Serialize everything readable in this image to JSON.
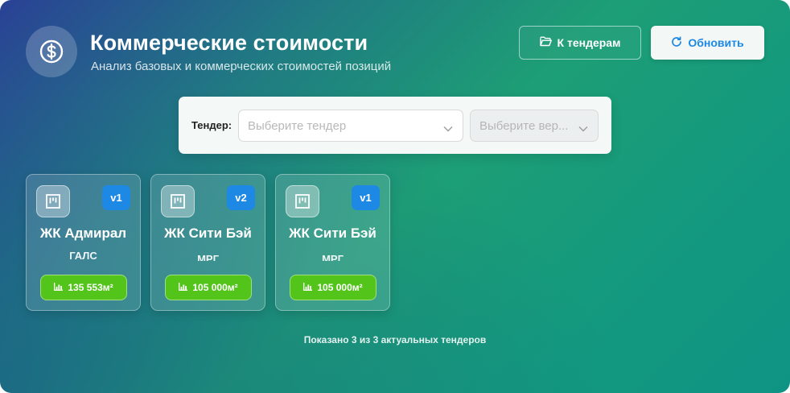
{
  "header": {
    "icon": "dollar-icon",
    "title": "Коммерческие стоимости",
    "subtitle": "Анализ базовых и коммерческих стоимостей позиций"
  },
  "actions": {
    "tenders_label": "К тендерам",
    "tenders_icon": "folder-open-icon",
    "refresh_label": "Обновить",
    "refresh_icon": "refresh-icon",
    "refresh_color": "#1e88e5"
  },
  "filter": {
    "label": "Тендер:",
    "tender_placeholder": "Выберите тендер",
    "version_placeholder": "Выберите вер..."
  },
  "tenders": [
    {
      "title": "ЖК Адмирал",
      "client": "ГАЛС",
      "version": "v1",
      "area": "135 553м²"
    },
    {
      "title": "ЖК Сити Бэй",
      "client": "МРГ",
      "version": "v2",
      "area": "105 000м²"
    },
    {
      "title": "ЖК Сити Бэй",
      "client": "МРГ",
      "version": "v1",
      "area": "105 000м²"
    }
  ],
  "colors": {
    "version_badge": "#1e88e5",
    "area_badge": "#52c41a"
  },
  "footer": {
    "note": "Показано 3 из 3 актуальных тендеров"
  }
}
